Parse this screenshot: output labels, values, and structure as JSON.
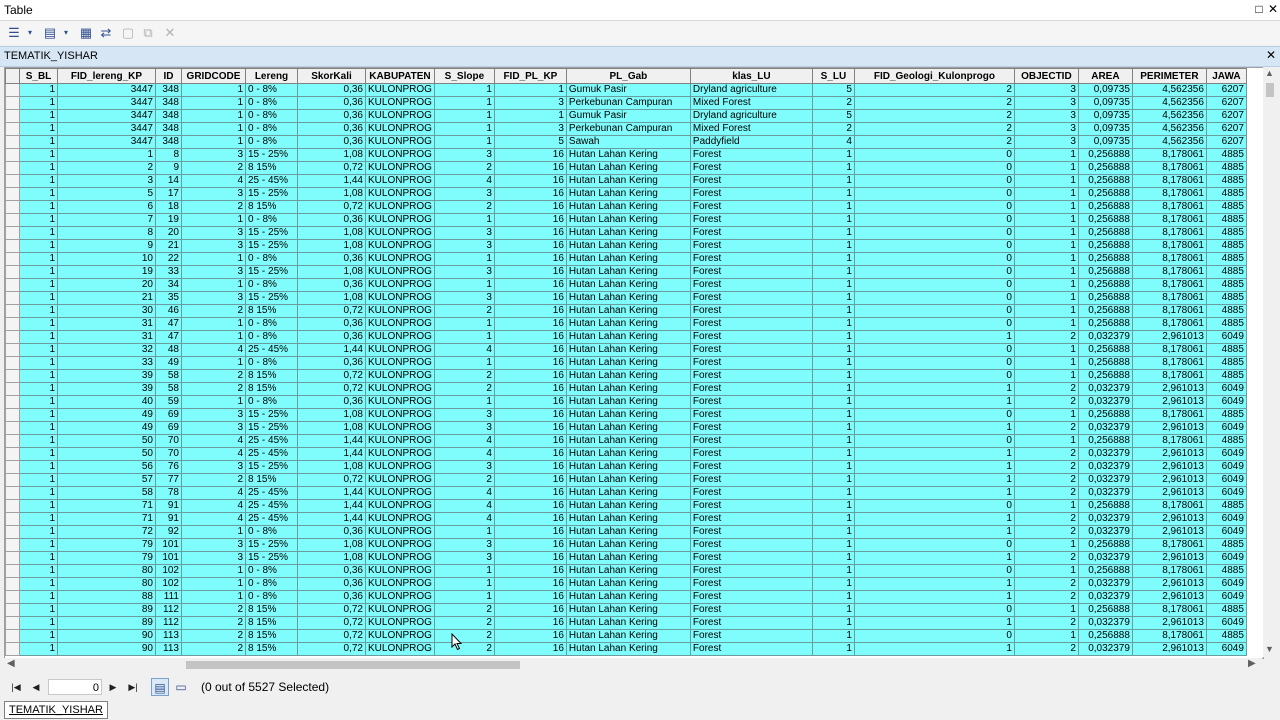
{
  "window": {
    "title": "Table"
  },
  "tab": {
    "name": "TEMATIK_YISHAR"
  },
  "columns": [
    "S_BL",
    "FID_lereng_KP",
    "ID",
    "GRIDCODE",
    "Lereng",
    "SkorKali",
    "KABUPATEN",
    "S_Slope",
    "FID_PL_KP",
    "PL_Gab",
    "klas_LU",
    "S_LU",
    "FID_Geologi_Kulonprogo",
    "OBJECTID",
    "AREA",
    "PERIMETER",
    "JAWA"
  ],
  "rows": [
    [
      "1",
      "3447",
      "348",
      "1",
      "0 - 8%",
      "0,36",
      "KULONPROG",
      "1",
      "1",
      "Gumuk Pasir",
      "Dryland agriculture",
      "5",
      "2",
      "3",
      "0,09735",
      "4,562356",
      "6207"
    ],
    [
      "1",
      "3447",
      "348",
      "1",
      "0 - 8%",
      "0,36",
      "KULONPROG",
      "1",
      "3",
      "Perkebunan Campuran",
      "Mixed Forest",
      "2",
      "2",
      "3",
      "0,09735",
      "4,562356",
      "6207"
    ],
    [
      "1",
      "3447",
      "348",
      "1",
      "0 - 8%",
      "0,36",
      "KULONPROG",
      "1",
      "1",
      "Gumuk Pasir",
      "Dryland agriculture",
      "5",
      "2",
      "3",
      "0,09735",
      "4,562356",
      "6207"
    ],
    [
      "1",
      "3447",
      "348",
      "1",
      "0 - 8%",
      "0,36",
      "KULONPROG",
      "1",
      "3",
      "Perkebunan Campuran",
      "Mixed Forest",
      "2",
      "2",
      "3",
      "0,09735",
      "4,562356",
      "6207"
    ],
    [
      "1",
      "3447",
      "348",
      "1",
      "0 - 8%",
      "0,36",
      "KULONPROG",
      "1",
      "5",
      "Sawah",
      "Paddyfield",
      "4",
      "2",
      "3",
      "0,09735",
      "4,562356",
      "6207"
    ],
    [
      "1",
      "1",
      "8",
      "3",
      "15 - 25%",
      "1,08",
      "KULONPROG",
      "3",
      "16",
      "Hutan Lahan Kering",
      "Forest",
      "1",
      "0",
      "1",
      "0,256888",
      "8,178061",
      "4885"
    ],
    [
      "1",
      "2",
      "9",
      "2",
      "8 15%",
      "0,72",
      "KULONPROG",
      "2",
      "16",
      "Hutan Lahan Kering",
      "Forest",
      "1",
      "0",
      "1",
      "0,256888",
      "8,178061",
      "4885"
    ],
    [
      "1",
      "3",
      "14",
      "4",
      "25 - 45%",
      "1,44",
      "KULONPROG",
      "4",
      "16",
      "Hutan Lahan Kering",
      "Forest",
      "1",
      "0",
      "1",
      "0,256888",
      "8,178061",
      "4885"
    ],
    [
      "1",
      "5",
      "17",
      "3",
      "15 - 25%",
      "1,08",
      "KULONPROG",
      "3",
      "16",
      "Hutan Lahan Kering",
      "Forest",
      "1",
      "0",
      "1",
      "0,256888",
      "8,178061",
      "4885"
    ],
    [
      "1",
      "6",
      "18",
      "2",
      "8 15%",
      "0,72",
      "KULONPROG",
      "2",
      "16",
      "Hutan Lahan Kering",
      "Forest",
      "1",
      "0",
      "1",
      "0,256888",
      "8,178061",
      "4885"
    ],
    [
      "1",
      "7",
      "19",
      "1",
      "0 - 8%",
      "0,36",
      "KULONPROG",
      "1",
      "16",
      "Hutan Lahan Kering",
      "Forest",
      "1",
      "0",
      "1",
      "0,256888",
      "8,178061",
      "4885"
    ],
    [
      "1",
      "8",
      "20",
      "3",
      "15 - 25%",
      "1,08",
      "KULONPROG",
      "3",
      "16",
      "Hutan Lahan Kering",
      "Forest",
      "1",
      "0",
      "1",
      "0,256888",
      "8,178061",
      "4885"
    ],
    [
      "1",
      "9",
      "21",
      "3",
      "15 - 25%",
      "1,08",
      "KULONPROG",
      "3",
      "16",
      "Hutan Lahan Kering",
      "Forest",
      "1",
      "0",
      "1",
      "0,256888",
      "8,178061",
      "4885"
    ],
    [
      "1",
      "10",
      "22",
      "1",
      "0 - 8%",
      "0,36",
      "KULONPROG",
      "1",
      "16",
      "Hutan Lahan Kering",
      "Forest",
      "1",
      "0",
      "1",
      "0,256888",
      "8,178061",
      "4885"
    ],
    [
      "1",
      "19",
      "33",
      "3",
      "15 - 25%",
      "1,08",
      "KULONPROG",
      "3",
      "16",
      "Hutan Lahan Kering",
      "Forest",
      "1",
      "0",
      "1",
      "0,256888",
      "8,178061",
      "4885"
    ],
    [
      "1",
      "20",
      "34",
      "1",
      "0 - 8%",
      "0,36",
      "KULONPROG",
      "1",
      "16",
      "Hutan Lahan Kering",
      "Forest",
      "1",
      "0",
      "1",
      "0,256888",
      "8,178061",
      "4885"
    ],
    [
      "1",
      "21",
      "35",
      "3",
      "15 - 25%",
      "1,08",
      "KULONPROG",
      "3",
      "16",
      "Hutan Lahan Kering",
      "Forest",
      "1",
      "0",
      "1",
      "0,256888",
      "8,178061",
      "4885"
    ],
    [
      "1",
      "30",
      "46",
      "2",
      "8 15%",
      "0,72",
      "KULONPROG",
      "2",
      "16",
      "Hutan Lahan Kering",
      "Forest",
      "1",
      "0",
      "1",
      "0,256888",
      "8,178061",
      "4885"
    ],
    [
      "1",
      "31",
      "47",
      "1",
      "0 - 8%",
      "0,36",
      "KULONPROG",
      "1",
      "16",
      "Hutan Lahan Kering",
      "Forest",
      "1",
      "0",
      "1",
      "0,256888",
      "8,178061",
      "4885"
    ],
    [
      "1",
      "31",
      "47",
      "1",
      "0 - 8%",
      "0,36",
      "KULONPROG",
      "1",
      "16",
      "Hutan Lahan Kering",
      "Forest",
      "1",
      "1",
      "2",
      "0,032379",
      "2,961013",
      "6049"
    ],
    [
      "1",
      "32",
      "48",
      "4",
      "25 - 45%",
      "1,44",
      "KULONPROG",
      "4",
      "16",
      "Hutan Lahan Kering",
      "Forest",
      "1",
      "0",
      "1",
      "0,256888",
      "8,178061",
      "4885"
    ],
    [
      "1",
      "33",
      "49",
      "1",
      "0 - 8%",
      "0,36",
      "KULONPROG",
      "1",
      "16",
      "Hutan Lahan Kering",
      "Forest",
      "1",
      "0",
      "1",
      "0,256888",
      "8,178061",
      "4885"
    ],
    [
      "1",
      "39",
      "58",
      "2",
      "8 15%",
      "0,72",
      "KULONPROG",
      "2",
      "16",
      "Hutan Lahan Kering",
      "Forest",
      "1",
      "0",
      "1",
      "0,256888",
      "8,178061",
      "4885"
    ],
    [
      "1",
      "39",
      "58",
      "2",
      "8 15%",
      "0,72",
      "KULONPROG",
      "2",
      "16",
      "Hutan Lahan Kering",
      "Forest",
      "1",
      "1",
      "2",
      "0,032379",
      "2,961013",
      "6049"
    ],
    [
      "1",
      "40",
      "59",
      "1",
      "0 - 8%",
      "0,36",
      "KULONPROG",
      "1",
      "16",
      "Hutan Lahan Kering",
      "Forest",
      "1",
      "1",
      "2",
      "0,032379",
      "2,961013",
      "6049"
    ],
    [
      "1",
      "49",
      "69",
      "3",
      "15 - 25%",
      "1,08",
      "KULONPROG",
      "3",
      "16",
      "Hutan Lahan Kering",
      "Forest",
      "1",
      "0",
      "1",
      "0,256888",
      "8,178061",
      "4885"
    ],
    [
      "1",
      "49",
      "69",
      "3",
      "15 - 25%",
      "1,08",
      "KULONPROG",
      "3",
      "16",
      "Hutan Lahan Kering",
      "Forest",
      "1",
      "1",
      "2",
      "0,032379",
      "2,961013",
      "6049"
    ],
    [
      "1",
      "50",
      "70",
      "4",
      "25 - 45%",
      "1,44",
      "KULONPROG",
      "4",
      "16",
      "Hutan Lahan Kering",
      "Forest",
      "1",
      "0",
      "1",
      "0,256888",
      "8,178061",
      "4885"
    ],
    [
      "1",
      "50",
      "70",
      "4",
      "25 - 45%",
      "1,44",
      "KULONPROG",
      "4",
      "16",
      "Hutan Lahan Kering",
      "Forest",
      "1",
      "1",
      "2",
      "0,032379",
      "2,961013",
      "6049"
    ],
    [
      "1",
      "56",
      "76",
      "3",
      "15 - 25%",
      "1,08",
      "KULONPROG",
      "3",
      "16",
      "Hutan Lahan Kering",
      "Forest",
      "1",
      "1",
      "2",
      "0,032379",
      "2,961013",
      "6049"
    ],
    [
      "1",
      "57",
      "77",
      "2",
      "8 15%",
      "0,72",
      "KULONPROG",
      "2",
      "16",
      "Hutan Lahan Kering",
      "Forest",
      "1",
      "1",
      "2",
      "0,032379",
      "2,961013",
      "6049"
    ],
    [
      "1",
      "58",
      "78",
      "4",
      "25 - 45%",
      "1,44",
      "KULONPROG",
      "4",
      "16",
      "Hutan Lahan Kering",
      "Forest",
      "1",
      "1",
      "2",
      "0,032379",
      "2,961013",
      "6049"
    ],
    [
      "1",
      "71",
      "91",
      "4",
      "25 - 45%",
      "1,44",
      "KULONPROG",
      "4",
      "16",
      "Hutan Lahan Kering",
      "Forest",
      "1",
      "0",
      "1",
      "0,256888",
      "8,178061",
      "4885"
    ],
    [
      "1",
      "71",
      "91",
      "4",
      "25 - 45%",
      "1,44",
      "KULONPROG",
      "4",
      "16",
      "Hutan Lahan Kering",
      "Forest",
      "1",
      "1",
      "2",
      "0,032379",
      "2,961013",
      "6049"
    ],
    [
      "1",
      "72",
      "92",
      "1",
      "0 - 8%",
      "0,36",
      "KULONPROG",
      "1",
      "16",
      "Hutan Lahan Kering",
      "Forest",
      "1",
      "1",
      "2",
      "0,032379",
      "2,961013",
      "6049"
    ],
    [
      "1",
      "79",
      "101",
      "3",
      "15 - 25%",
      "1,08",
      "KULONPROG",
      "3",
      "16",
      "Hutan Lahan Kering",
      "Forest",
      "1",
      "0",
      "1",
      "0,256888",
      "8,178061",
      "4885"
    ],
    [
      "1",
      "79",
      "101",
      "3",
      "15 - 25%",
      "1,08",
      "KULONPROG",
      "3",
      "16",
      "Hutan Lahan Kering",
      "Forest",
      "1",
      "1",
      "2",
      "0,032379",
      "2,961013",
      "6049"
    ],
    [
      "1",
      "80",
      "102",
      "1",
      "0 - 8%",
      "0,36",
      "KULONPROG",
      "1",
      "16",
      "Hutan Lahan Kering",
      "Forest",
      "1",
      "0",
      "1",
      "0,256888",
      "8,178061",
      "4885"
    ],
    [
      "1",
      "80",
      "102",
      "1",
      "0 - 8%",
      "0,36",
      "KULONPROG",
      "1",
      "16",
      "Hutan Lahan Kering",
      "Forest",
      "1",
      "1",
      "2",
      "0,032379",
      "2,961013",
      "6049"
    ],
    [
      "1",
      "88",
      "111",
      "1",
      "0 - 8%",
      "0,36",
      "KULONPROG",
      "1",
      "16",
      "Hutan Lahan Kering",
      "Forest",
      "1",
      "1",
      "2",
      "0,032379",
      "2,961013",
      "6049"
    ],
    [
      "1",
      "89",
      "112",
      "2",
      "8 15%",
      "0,72",
      "KULONPROG",
      "2",
      "16",
      "Hutan Lahan Kering",
      "Forest",
      "1",
      "0",
      "1",
      "0,256888",
      "8,178061",
      "4885"
    ],
    [
      "1",
      "89",
      "112",
      "2",
      "8 15%",
      "0,72",
      "KULONPROG",
      "2",
      "16",
      "Hutan Lahan Kering",
      "Forest",
      "1",
      "1",
      "2",
      "0,032379",
      "2,961013",
      "6049"
    ],
    [
      "1",
      "90",
      "113",
      "2",
      "8 15%",
      "0,72",
      "KULONPROG",
      "2",
      "16",
      "Hutan Lahan Kering",
      "Forest",
      "1",
      "0",
      "1",
      "0,256888",
      "8,178061",
      "4885"
    ],
    [
      "1",
      "90",
      "113",
      "2",
      "8 15%",
      "0,72",
      "KULONPROG",
      "2",
      "16",
      "Hutan Lahan Kering",
      "Forest",
      "1",
      "1",
      "2",
      "0,032379",
      "2,961013",
      "6049"
    ]
  ],
  "navigation": {
    "current_record": "0",
    "status": "(0 out of 5527 Selected)"
  },
  "bottom_tab": {
    "label": "TEMATIK_YISHAR"
  },
  "colors": {
    "row_background": "#7ffcfc",
    "header_background": "#f0f0f0",
    "tabstrip": "#d6e6f5"
  },
  "icons": {
    "table_options": "table-options-icon",
    "related_tables": "related-tables-icon",
    "select_by_attributes": "select-by-attributes-icon",
    "switch_selection": "switch-selection-icon",
    "clear_selection": "clear-selection-icon",
    "zoom_to_selected": "zoom-to-selected-icon",
    "delete_selected": "delete-selected-icon"
  }
}
